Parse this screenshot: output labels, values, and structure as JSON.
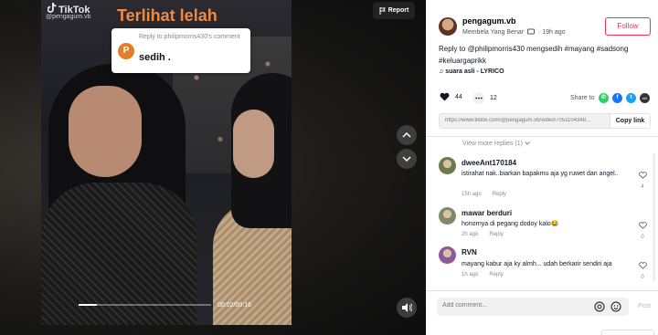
{
  "video": {
    "watermark_brand": "TikTok",
    "watermark_user": "@pengagum.vb",
    "overlay_caption": "Terlihat lelah",
    "reply_card": {
      "avatar_letter": "P",
      "header": "Reply to philipmorris430's comment",
      "body": "sedih ."
    },
    "report_label": "Report",
    "time": "00:02/00:16",
    "progress": 0.14
  },
  "author": {
    "username": "pengagum.vb",
    "display_name": "Membela Yang Benar",
    "posted": "19h ago",
    "follow_label": "Follow"
  },
  "caption": {
    "prefix": "Reply to ",
    "mention": "@philipmorris430",
    "text": " mengsedih ",
    "hashtags": [
      "#mayang",
      "#sadsong",
      "#keluargaprikk"
    ]
  },
  "music": "suara asli - LYRICO",
  "stats": {
    "likes": "44",
    "comments": "12"
  },
  "share": {
    "label": "Share to",
    "targets": [
      {
        "name": "whatsapp-icon",
        "glyph": "✆",
        "color": "#25d366"
      },
      {
        "name": "facebook-icon",
        "glyph": "f",
        "color": "#1877f2"
      },
      {
        "name": "twitter-icon",
        "glyph": "t",
        "color": "#1da1f2"
      },
      {
        "name": "embed-icon",
        "glyph": "</>",
        "color": "#333333"
      }
    ]
  },
  "link": {
    "url": "https://www.tiktok.com/@pengagum.vb/video/7051104348...",
    "copy_label": "Copy link"
  },
  "more_replies": "View more replies (1)",
  "comments": [
    {
      "user": "dweeAnt170184",
      "text": "istirahat nak..biarkan bapakmu aja yg ruwet dan angel..",
      "time": "15h ago",
      "reply": "Reply",
      "likes": "4",
      "avatar": "#6b7a4a"
    },
    {
      "user": "mawar berduri",
      "text": "honornya di pegang dodoy kalo😂",
      "time": "2h ago",
      "reply": "Reply",
      "likes": "0",
      "avatar": "#7d8a6a"
    },
    {
      "user": "RVN",
      "text": "mayang kabur aja ky almh... udah berkarir sendiri aja",
      "time": "1h ago",
      "reply": "Reply",
      "likes": "0",
      "avatar": "#8a5a9a"
    }
  ],
  "comment_input": {
    "placeholder": "Add comment...",
    "post_label": "Post"
  }
}
